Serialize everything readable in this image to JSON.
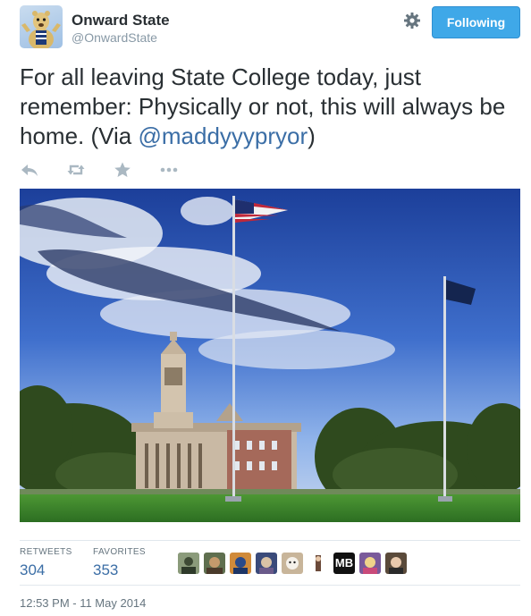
{
  "user": {
    "display_name": "Onward State",
    "handle": "@OnwardState"
  },
  "follow_button": {
    "label": "Following"
  },
  "tweet": {
    "text": "For all leaving State College today, just remember: Physically or not, this will always be home. (Via ",
    "mention": "@maddyyypryor",
    "text_end": ")"
  },
  "actions": {
    "icons": [
      "reply-icon",
      "retweet-icon",
      "favorite-icon",
      "more-icon"
    ]
  },
  "stats": {
    "retweets_label": "RETWEETS",
    "retweets_value": "304",
    "favorites_label": "FAVORITES",
    "favorites_value": "353"
  },
  "favoriters": {
    "count_shown": 9,
    "badge_text": "MB"
  },
  "timestamp": "12:53 PM - 11 May 2014",
  "colors": {
    "accent": "#3fa8e8",
    "link": "#3b6ea6",
    "muted": "#66757f"
  }
}
